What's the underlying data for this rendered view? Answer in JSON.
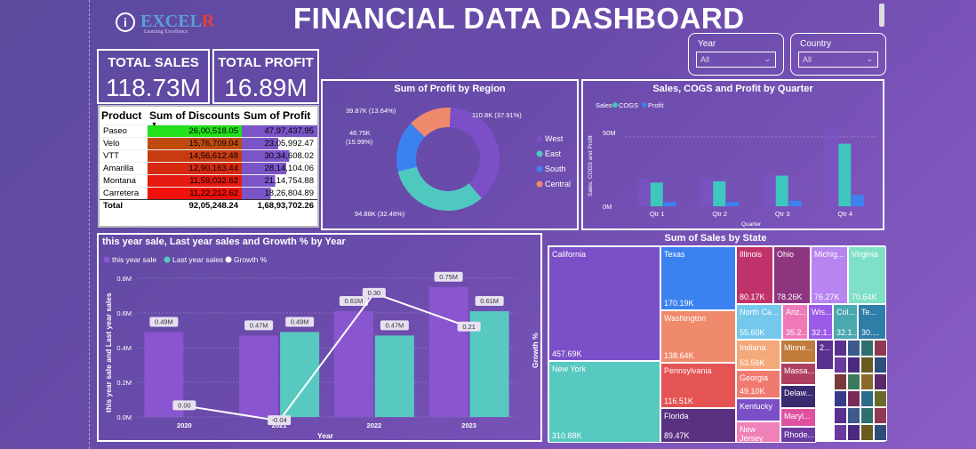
{
  "header": {
    "title": "FINANCIAL DATA DASHBOARD",
    "info_icon": "i",
    "logo_main": "EXCEL",
    "logo_r": "R",
    "logo_tag": "Learning Excellence"
  },
  "kpis": {
    "total_sales_label": "TOTAL SALES",
    "total_sales": "118.73M",
    "total_profit_label": "TOTAL PROFIT",
    "total_profit": "16.89M"
  },
  "slicers": {
    "year_label": "Year",
    "year_value": "All",
    "country_label": "Country",
    "country_value": "All"
  },
  "product_table": {
    "headers": [
      "Product",
      "Sum of Discounts",
      "Sum of Profit"
    ],
    "rows": [
      {
        "product": "Paseo",
        "discounts": "26,00,518.05",
        "profit": "47,97,437.95",
        "disc_color": "#22e01a",
        "profit_frac": 1.0
      },
      {
        "product": "Velo",
        "discounts": "15,76,709.04",
        "profit": "23,05,992.47",
        "disc_color": "#c04a0c",
        "profit_frac": 0.48
      },
      {
        "product": "VTT",
        "discounts": "14,56,612.48",
        "profit": "30,34,608.02",
        "disc_color": "#c83b10",
        "profit_frac": 0.63
      },
      {
        "product": "Amarilla",
        "discounts": "12,90,163.44",
        "profit": "28,14,104.06",
        "disc_color": "#d62a10",
        "profit_frac": 0.59
      },
      {
        "product": "Montana",
        "discounts": "11,59,032.62",
        "profit": "21,14,754.88",
        "disc_color": "#e51a10",
        "profit_frac": 0.44
      },
      {
        "product": "Carretera",
        "discounts": "11,22,212.62",
        "profit": "18,26,804.89",
        "disc_color": "#f0100c",
        "profit_frac": 0.38
      }
    ],
    "total": {
      "label": "Total",
      "discounts": "92,05,248.24",
      "profit": "1,68,93,702.26"
    }
  },
  "donut": {
    "title": "Sum of Profit by Region",
    "slices": [
      {
        "name": "West",
        "value": 110.8,
        "label": "110.8K (37.91%)",
        "color": "#7c4fc8"
      },
      {
        "name": "East",
        "value": 94.88,
        "label": "94.88K (32.46%)",
        "color": "#4fc9c0"
      },
      {
        "name": "South",
        "value": 46.75,
        "label": "46.75K (15.99%)",
        "color": "#3b82f0"
      },
      {
        "name": "Central",
        "value": 39.87,
        "label": "39.87K (13.64%)",
        "color": "#f08a6c"
      }
    ],
    "label_south_1": "46.75K",
    "label_south_2": "(15.99%)"
  },
  "quarter_chart": {
    "title": "Sales, COGS and Profit by Quarter",
    "legend": [
      "Sales",
      "COGS",
      "Profit"
    ],
    "colors": {
      "Sales": "#7b55c8",
      "COGS": "#3ec7bd",
      "Profit": "#3b82f0"
    },
    "ylabel": "Sales, COGS and Profit",
    "xlabel": "Quarter",
    "yticks": [
      "50M",
      "0M"
    ],
    "chart_data": {
      "type": "bar",
      "categories": [
        "Qtr 1",
        "Qtr 2",
        "Qtr 3",
        "Qtr 4"
      ],
      "series": [
        {
          "name": "Sales",
          "values": [
            20,
            20,
            23,
            55
          ]
        },
        {
          "name": "COGS",
          "values": [
            17,
            18,
            22,
            45
          ]
        },
        {
          "name": "Profit",
          "values": [
            3,
            3,
            4,
            8
          ]
        }
      ],
      "ylim": [
        0,
        55
      ]
    }
  },
  "growth_chart": {
    "title": "this year sale, Last year sales and Growth % by Year",
    "legend": [
      "this year sale",
      "Last year sales",
      "Growth %"
    ],
    "ylabel": "this year sale and Last year sales",
    "y2label": "Growth %",
    "xlabel": "Year",
    "yticks": [
      "0.8M",
      "0.6M",
      "0.4M",
      "0.2M",
      "0.0M"
    ],
    "chart_data": {
      "type": "bar",
      "categories": [
        "2020",
        "2021",
        "2022",
        "2023"
      ],
      "series": [
        {
          "name": "this year sale",
          "values": [
            0.49,
            0.47,
            0.61,
            0.75
          ],
          "labels": [
            "0.49M",
            "0.47M",
            "0.61M",
            "0.75M"
          ]
        },
        {
          "name": "Last year sales",
          "values": [
            null,
            0.49,
            0.47,
            0.61
          ],
          "labels": [
            "",
            "0.49M",
            "0.47M",
            "0.61M"
          ]
        },
        {
          "name": "Growth %",
          "values": [
            0.0,
            -0.04,
            0.3,
            0.21
          ],
          "labels": [
            "0.00",
            "-0.04",
            "0.30",
            "0.21"
          ]
        }
      ],
      "ylim": [
        0,
        0.8
      ]
    }
  },
  "treemap": {
    "title": "Sum of Sales by State",
    "cells": [
      {
        "name": "California",
        "value": "457.69K",
        "color": "#7b4fc8"
      },
      {
        "name": "New York",
        "value": "310.88K",
        "color": "#57c9c0"
      },
      {
        "name": "Texas",
        "value": "170.19K",
        "color": "#3b82f0"
      },
      {
        "name": "Washington",
        "value": "138.64K",
        "color": "#f08a6c"
      },
      {
        "name": "Pennsylvania",
        "value": "116.51K",
        "color": "#e45454"
      },
      {
        "name": "Florida",
        "value": "89.47K",
        "color": "#5a3080"
      },
      {
        "name": "Illinois",
        "value": "80.17K",
        "color": "#c0336a"
      },
      {
        "name": "Ohio",
        "value": "78.26K",
        "color": "#8e3580"
      },
      {
        "name": "Michig...",
        "value": "76.27K",
        "color": "#b784f0"
      },
      {
        "name": "Virginia",
        "value": "70.64K",
        "color": "#7fe0c8"
      },
      {
        "name": "North Ca...",
        "value": "55.60K",
        "color": "#74c8ec"
      },
      {
        "name": "Ariz...",
        "value": "35.2...",
        "color": "#f07ab8"
      },
      {
        "name": "Wis...",
        "value": "32.1...",
        "color": "#9c5ae8"
      },
      {
        "name": "Col...",
        "value": "32.1...",
        "color": "#4aa8b0"
      },
      {
        "name": "Te...",
        "value": "30....",
        "color": "#2f7ea8"
      },
      {
        "name": "Indiana",
        "value": "53.56K",
        "color": "#f4a97a"
      },
      {
        "name": "Georgia",
        "value": "49.10K",
        "color": "#f07a70"
      },
      {
        "name": "Kentucky",
        "value": "",
        "color": "#7b4fc8"
      },
      {
        "name": "New Jersey",
        "value": "",
        "color": "#f080b8"
      },
      {
        "name": "Minne...",
        "value": "",
        "color": "#c07a3a"
      },
      {
        "name": "Massa...",
        "value": "",
        "color": "#b04060"
      },
      {
        "name": "Delaw...",
        "value": "",
        "color": "#3a2a70"
      },
      {
        "name": "Maryl...",
        "value": "",
        "color": "#e050a0"
      },
      {
        "name": "Rhode...",
        "value": "",
        "color": "#6a3aa0"
      },
      {
        "name": "2...",
        "value": "",
        "color": "#5a3090"
      }
    ]
  }
}
